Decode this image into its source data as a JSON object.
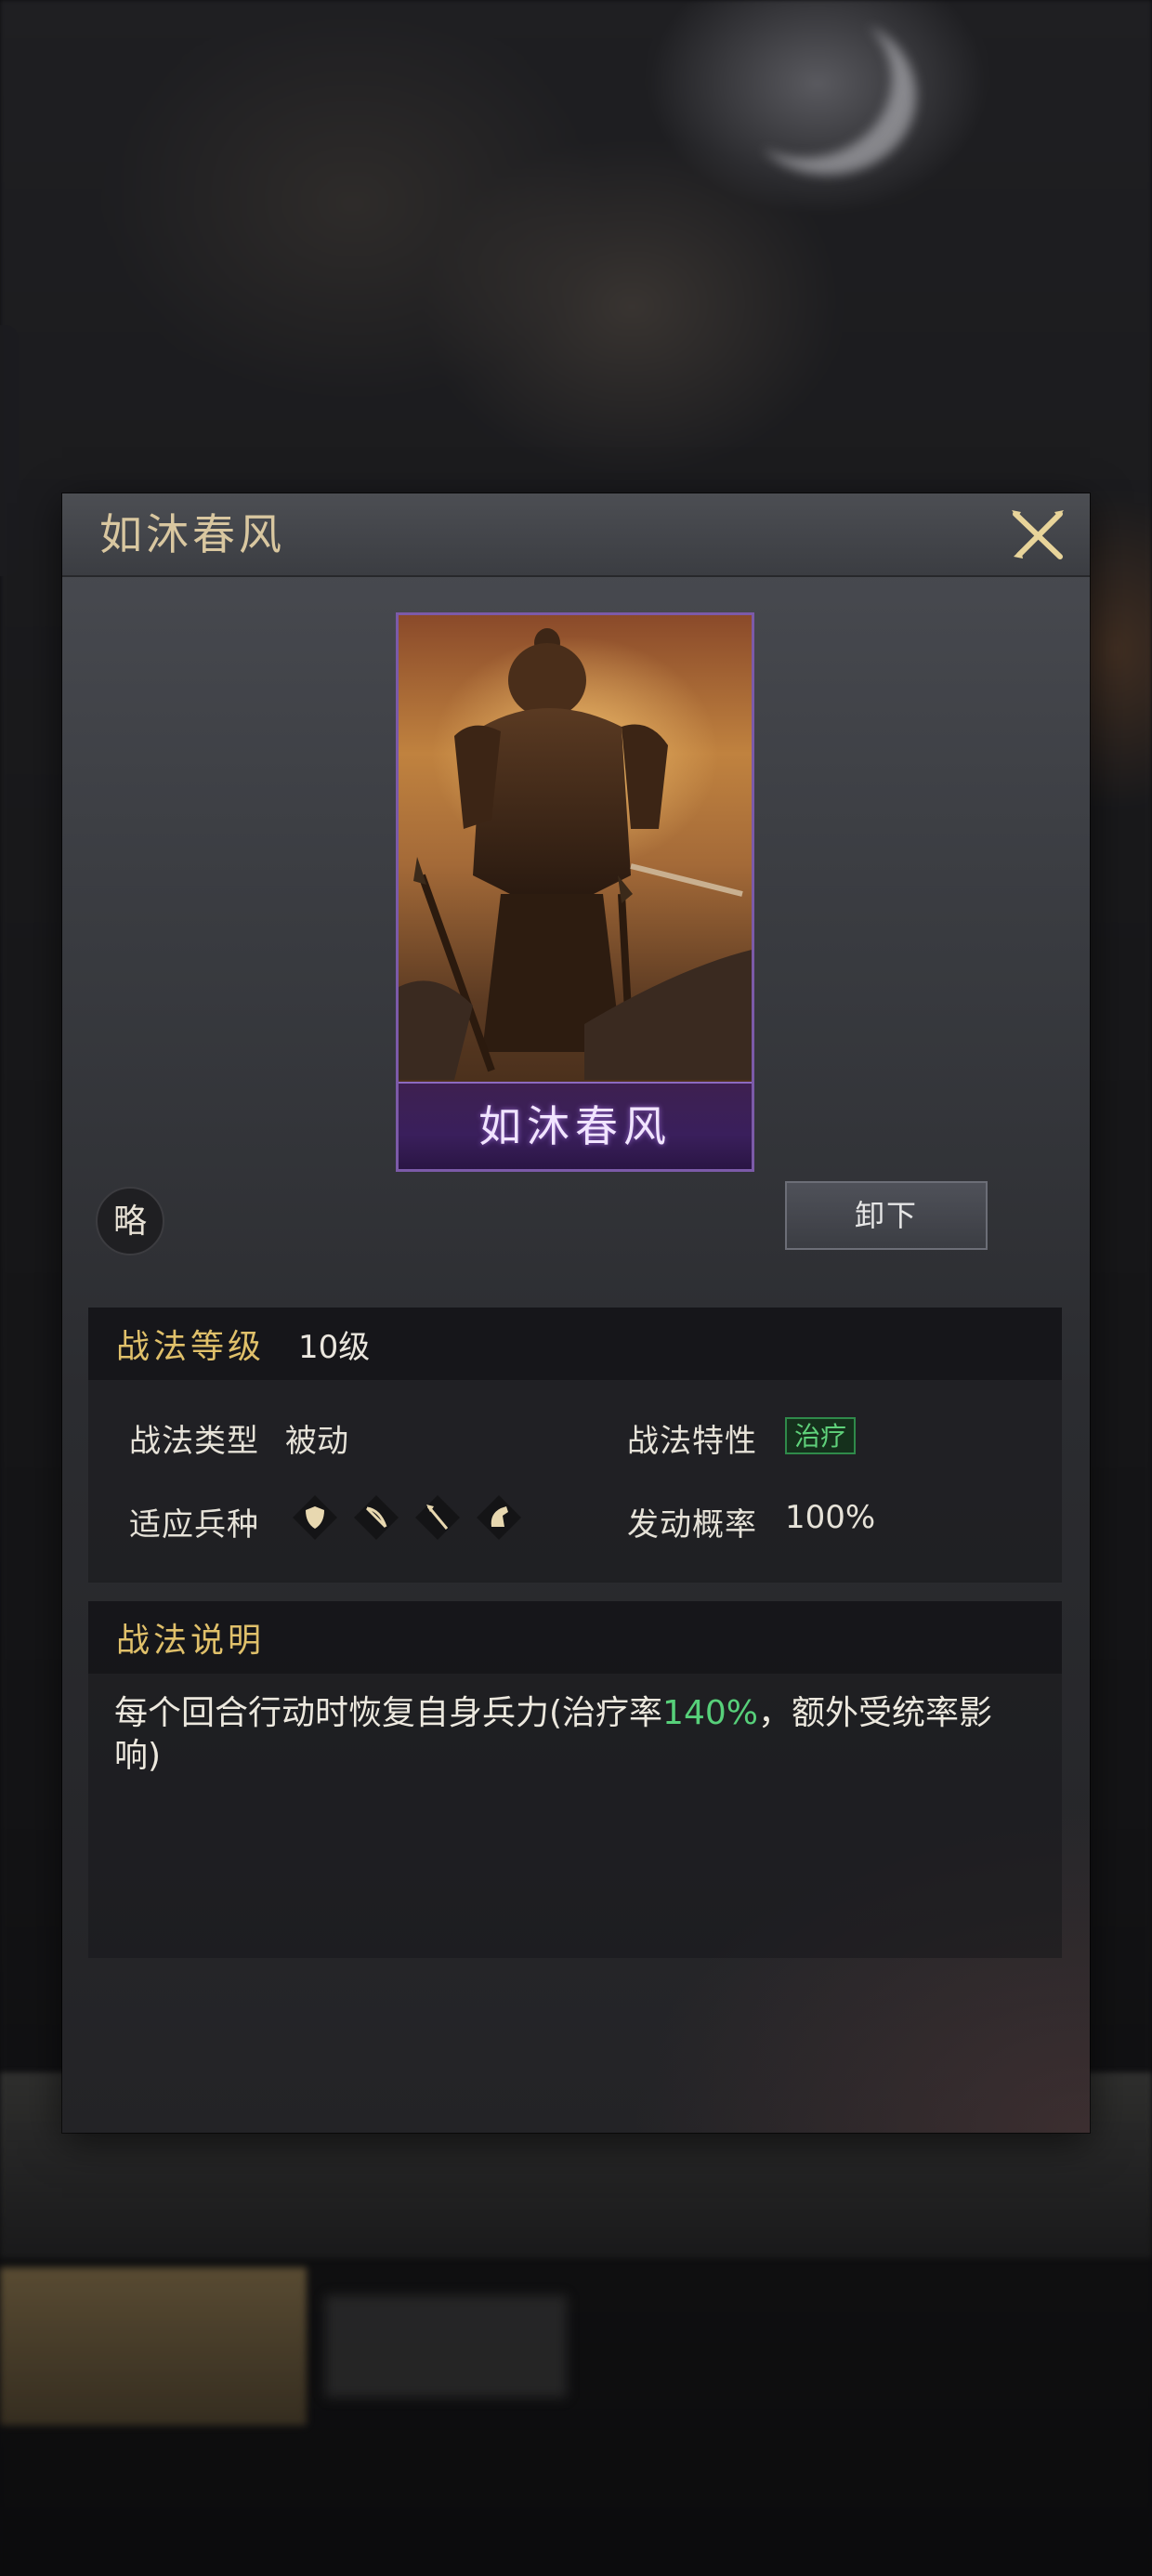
{
  "dialog": {
    "title": "如沐春风",
    "card_name": "如沐春风",
    "badge": "略",
    "unequip_label": "卸下"
  },
  "level_section": {
    "title": "战法等级",
    "value": "10级",
    "type_label": "战法类型",
    "type_value": "被动",
    "trait_label": "战法特性",
    "trait_tag": "治疗",
    "units_label": "适应兵种",
    "units_icons": [
      "shield-icon",
      "bow-icon",
      "spear-icon",
      "horse-icon"
    ],
    "chance_label": "发动概率",
    "chance_value": "100%"
  },
  "desc_section": {
    "title": "战法说明",
    "text_before": "每个回合行动时恢复自身兵力(治疗率",
    "highlight": "140%",
    "text_after": "，额外受统率影响)"
  },
  "colors": {
    "gold_title": "#e0c06a",
    "highlight_green": "#57d07a",
    "card_border": "#7c5aa8"
  }
}
